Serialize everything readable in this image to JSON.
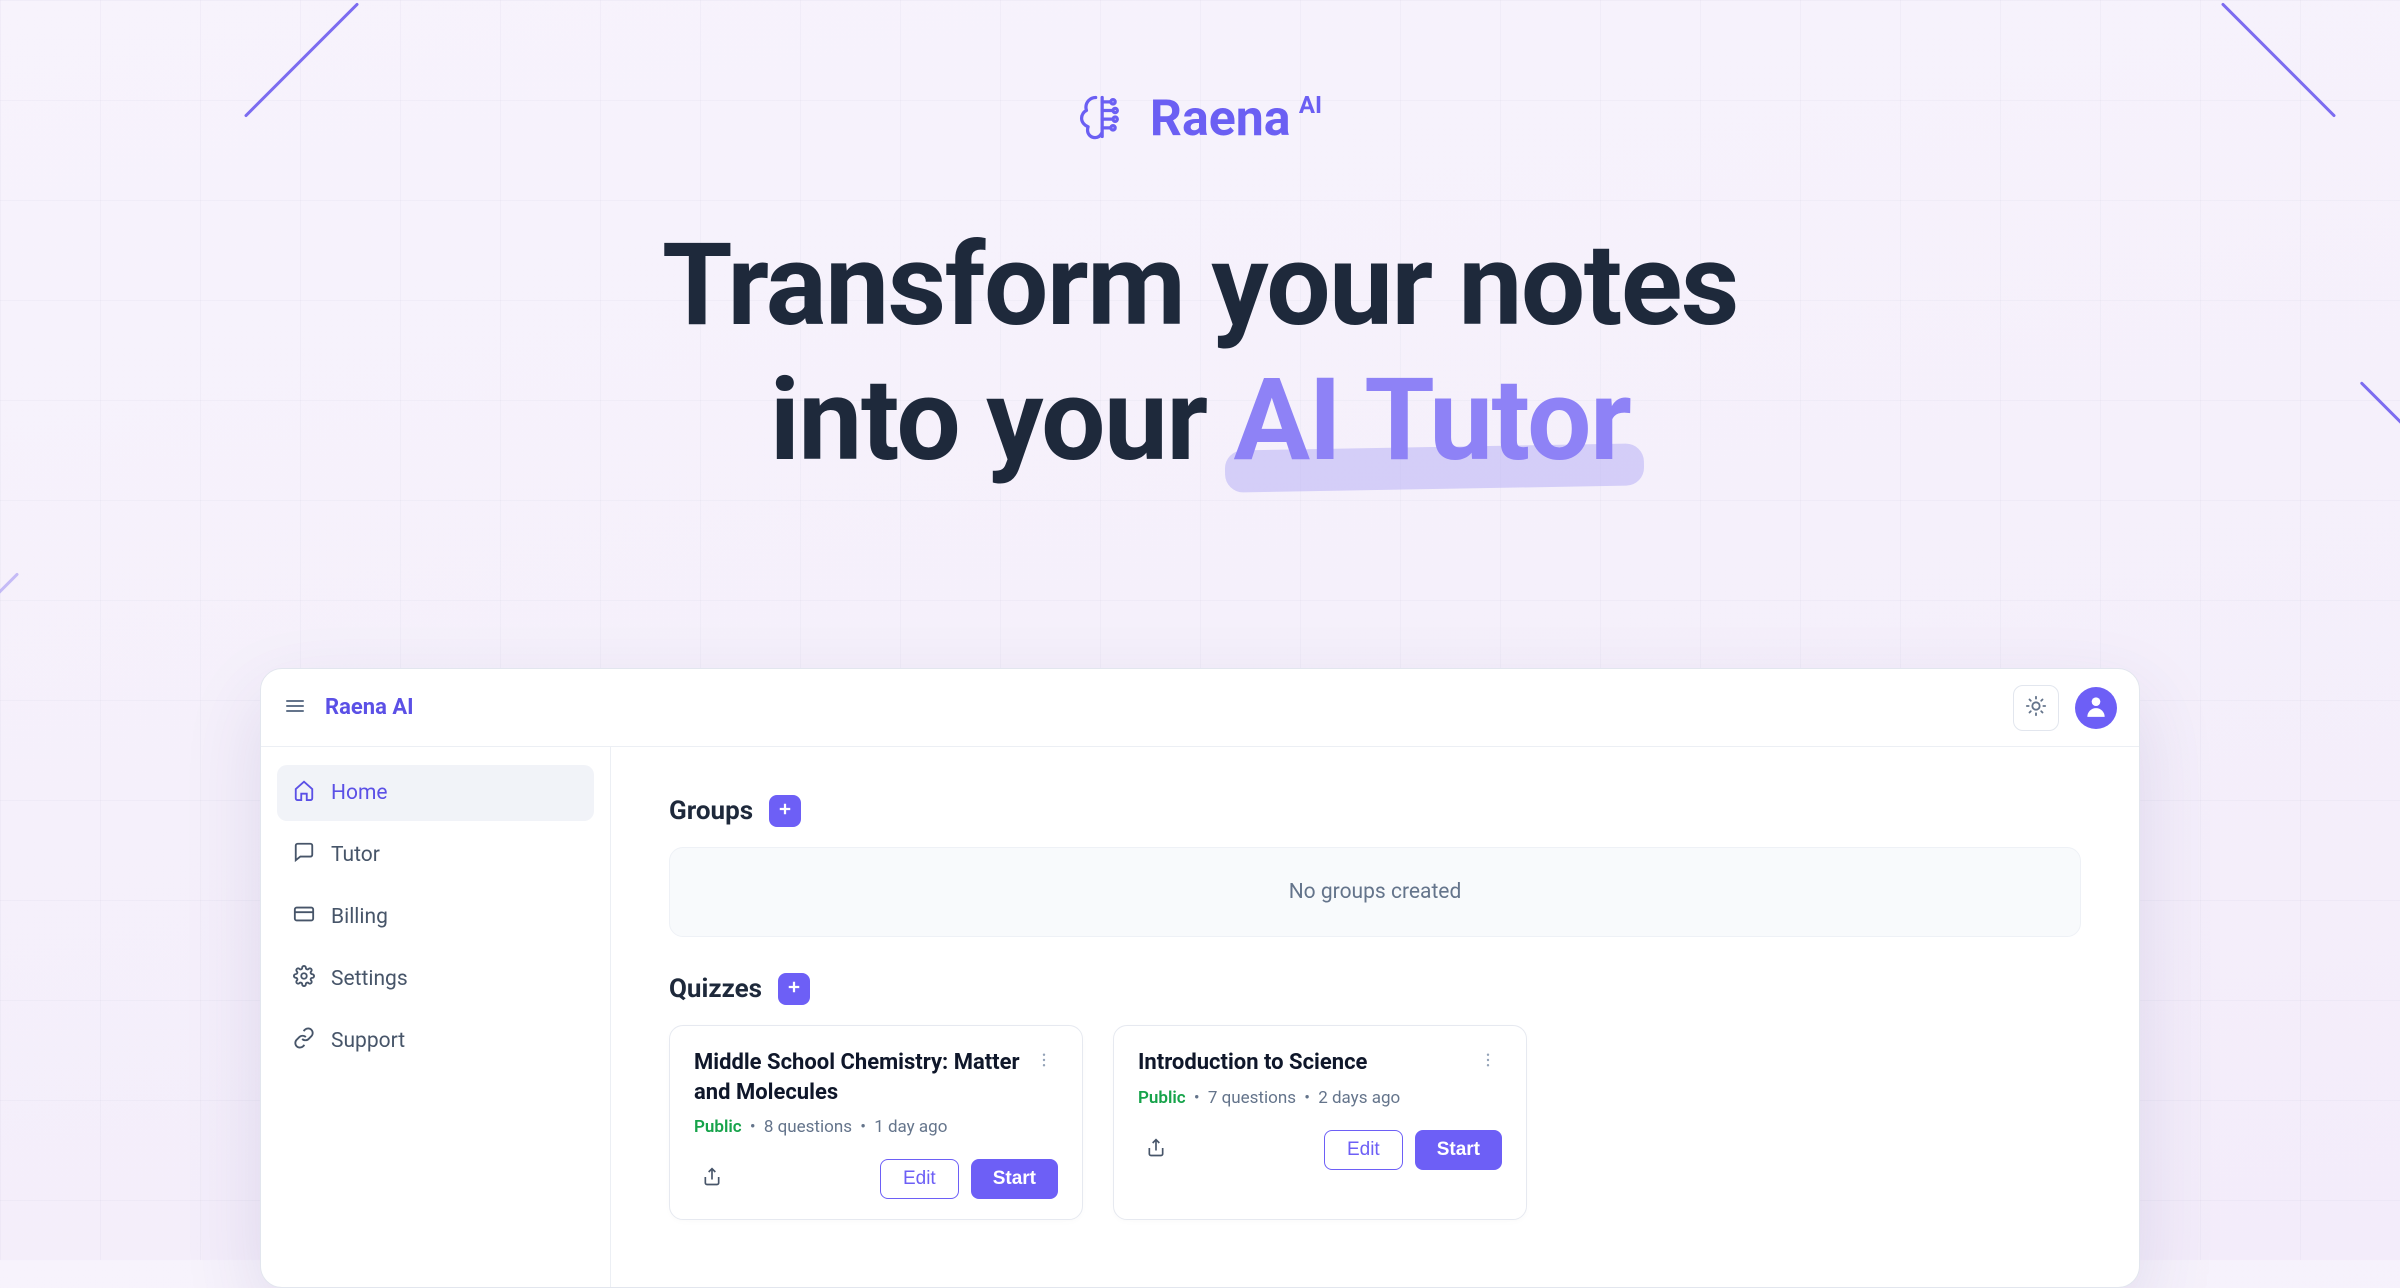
{
  "brand": {
    "name": "Raena",
    "suffix": "AI"
  },
  "hero": {
    "line1": "Transform your notes",
    "line2_prefix": "into your ",
    "line2_highlight": "AI Tutor"
  },
  "app": {
    "title": "Raena AI",
    "sidebar": {
      "items": [
        {
          "label": "Home",
          "icon": "home-icon",
          "active": true
        },
        {
          "label": "Tutor",
          "icon": "chat-icon",
          "active": false
        },
        {
          "label": "Billing",
          "icon": "card-icon",
          "active": false
        },
        {
          "label": "Settings",
          "icon": "gear-icon",
          "active": false
        },
        {
          "label": "Support",
          "icon": "link-icon",
          "active": false
        }
      ]
    },
    "sections": {
      "groups": {
        "title": "Groups",
        "empty_message": "No groups created"
      },
      "quizzes": {
        "title": "Quizzes",
        "cards": [
          {
            "title": "Middle School Chemistry: Matter and Molecules",
            "visibility": "Public",
            "questions": "8 questions",
            "age": "1 day ago",
            "edit_label": "Edit",
            "start_label": "Start"
          },
          {
            "title": "Introduction to Science",
            "visibility": "Public",
            "questions": "7 questions",
            "age": "2 days ago",
            "edit_label": "Edit",
            "start_label": "Start"
          }
        ]
      }
    }
  }
}
